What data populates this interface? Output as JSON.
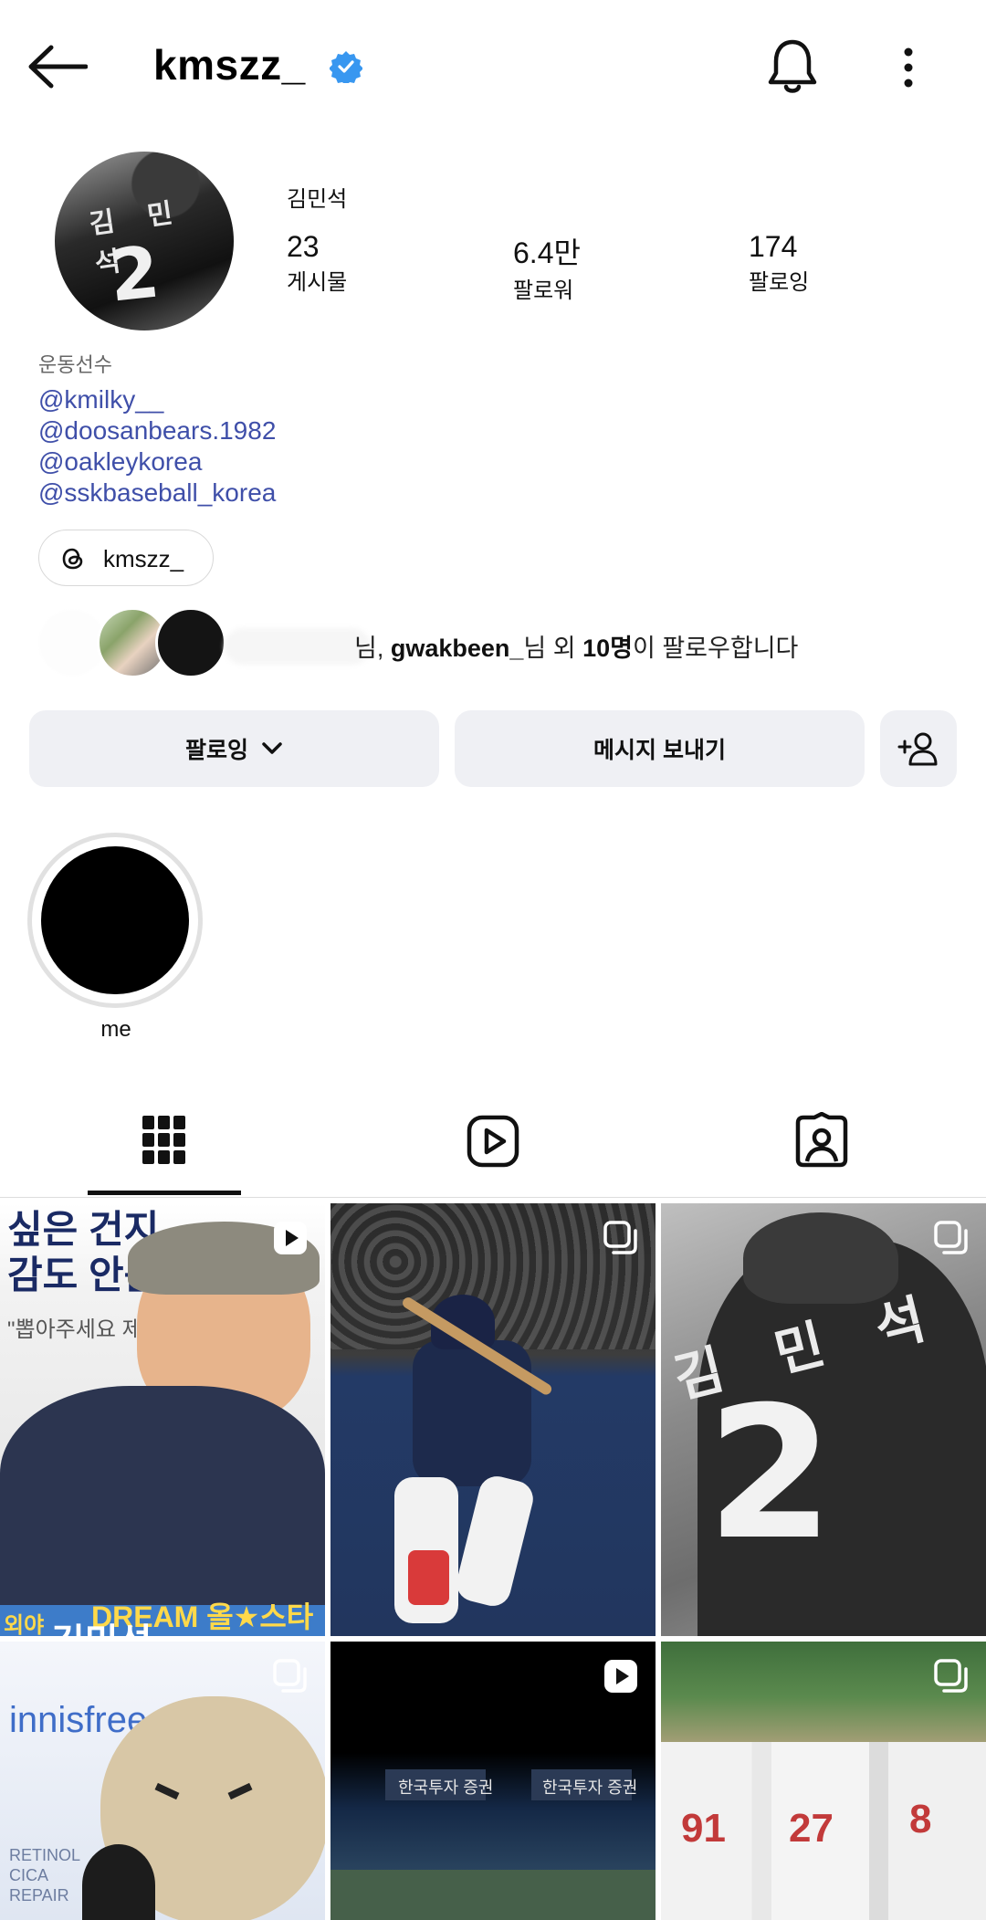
{
  "header": {
    "username": "kmszz_",
    "back_icon": "arrow-left-icon",
    "verified_icon": "verified-badge-icon",
    "bell_icon": "bell-icon",
    "more_icon": "more-vertical-icon"
  },
  "profile": {
    "full_name": "김민석",
    "avatar_jersey_name": "김 민 석",
    "avatar_jersey_number": "2",
    "stats": [
      {
        "value": "23",
        "label": "게시물"
      },
      {
        "value": "6.4만",
        "label": "팔로워"
      },
      {
        "value": "174",
        "label": "팔로잉"
      }
    ],
    "category": "운동선수",
    "mentions": [
      "@kmilky__",
      "@doosanbears.1982",
      "@oakleykorea",
      "@sskbaseball_korea"
    ],
    "threads": {
      "icon": "threads-icon",
      "label": "kmszz_"
    },
    "followed_by": {
      "prefix_partial": "님,",
      "name": "gwakbeen_",
      "mid": "님 외",
      "count": "10명",
      "suffix": "이 팔로우합니다"
    }
  },
  "actions": {
    "following_label": "팔로잉",
    "message_label": "메시지 보내기",
    "add_person_icon": "add-person-icon",
    "chevron_icon": "chevron-down-icon"
  },
  "highlights": [
    {
      "label": "me"
    }
  ],
  "tabs": [
    {
      "icon": "grid-icon",
      "active": true
    },
    {
      "icon": "reels-icon",
      "active": false
    },
    {
      "icon": "tagged-icon",
      "active": false
    }
  ],
  "posts": {
    "tile1": {
      "lines": [
        "싶은 건지",
        "감도 안옴"
      ],
      "caption": "\"뽑아주세요 제발\"",
      "banner": "DREAM 올★스타",
      "banner_small": "외야",
      "banner_name": "김민석",
      "type_icon": "reel-icon"
    },
    "tile2": {
      "type_icon": "carousel-icon"
    },
    "tile3": {
      "jersey_name": "김 민 석",
      "jersey_number": "2",
      "type_icon": "carousel-icon"
    },
    "tile4": {
      "sign": "innisfree",
      "left_text": [
        "RETINOL",
        "CICA",
        "REPAIR"
      ],
      "type_icon": "carousel-icon"
    },
    "tile5": {
      "boards": [
        "한국투자 증권",
        "한국투자 증권"
      ],
      "type_icon": "reel-icon"
    },
    "tile6": {
      "numbers": [
        "91",
        "27",
        "8"
      ],
      "type_icon": "carousel-icon"
    }
  }
}
